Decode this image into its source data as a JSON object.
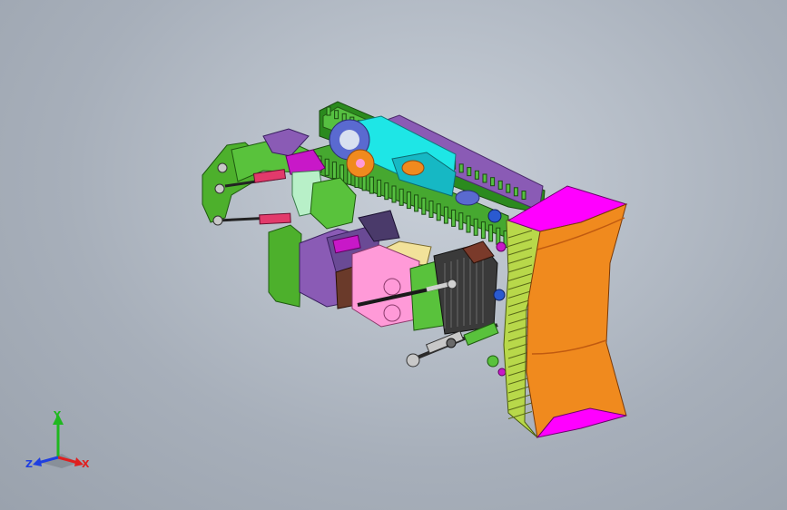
{
  "viewport": {
    "background_top": "#c9d0d9",
    "background_bottom": "#9aa2ad"
  },
  "model": {
    "description_icon": "bulldozer-assembly-3d-model",
    "colors": {
      "track": "#2b8a1e",
      "track_links": "#56c041",
      "blade_face": "#f08a1e",
      "blade_magenta": "#ff00ff",
      "blade_frame": "#b8d84a",
      "frame_purple": "#8a5bb5",
      "cyan_body": "#1ee6e6",
      "pink_body": "#ff9ad8",
      "green_body": "#59c23c",
      "ripper_green": "#4db02c",
      "hydraulic_red": "#e23a6b",
      "cabin_dark": "#5a4a7a"
    }
  },
  "triad": {
    "y_label": "Y",
    "z_label": "Z",
    "x_label": "X",
    "colors": {
      "y": "#1fb81f",
      "z": "#1f3fe0",
      "x": "#e01f1f"
    }
  }
}
